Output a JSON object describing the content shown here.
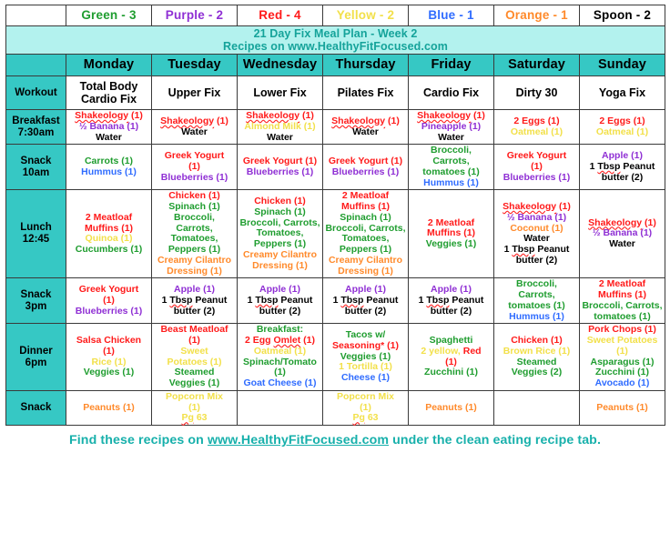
{
  "portions": [
    {
      "label": "Green - 3",
      "color": "#1f9d2f"
    },
    {
      "label": "Purple - 2",
      "color": "#8f2fd4"
    },
    {
      "label": "Red - 4",
      "color": "#ff1a1a"
    },
    {
      "label": "Yellow - 2",
      "color": "#f2e04a"
    },
    {
      "label": "Blue - 1",
      "color": "#2f6cff"
    },
    {
      "label": "Orange - 1",
      "color": "#ff8a2b"
    },
    {
      "label": "Spoon - 2",
      "color": "#000000"
    }
  ],
  "title": {
    "line1": "21 Day Fix Meal Plan - Week 2",
    "line2": "Recipes on www.HealthyFitFocused.com"
  },
  "days": [
    "Monday",
    "Tuesday",
    "Wednesday",
    "Thursday",
    "Friday",
    "Saturday",
    "Sunday"
  ],
  "rows": [
    {
      "label": "Workout",
      "label_line2": "",
      "cells": [
        [
          {
            "text": "Total Body",
            "color": "black"
          },
          {
            "text": "Cardio Fix",
            "color": "black"
          }
        ],
        [
          {
            "text": "Upper Fix",
            "color": "black"
          }
        ],
        [
          {
            "text": "Lower Fix",
            "color": "black"
          }
        ],
        [
          {
            "text": "Pilates Fix",
            "color": "black"
          }
        ],
        [
          {
            "text": "Cardio Fix",
            "color": "black"
          }
        ],
        [
          {
            "text": "Dirty 30",
            "color": "black"
          }
        ],
        [
          {
            "text": "Yoga Fix",
            "color": "black"
          }
        ]
      ]
    },
    {
      "label": "Breakfast",
      "label_line2": "7:30am",
      "cells": [
        [
          {
            "text": "Shakeology (1)",
            "color": "red",
            "spell": "Shakeology"
          },
          {
            "text": "½ Banana (1)",
            "color": "purple"
          },
          {
            "text": "Water",
            "color": "black"
          }
        ],
        [
          {
            "text": "Shakeology (1)",
            "color": "red",
            "spell": "Shakeology"
          },
          {
            "text": "Water",
            "color": "black"
          }
        ],
        [
          {
            "text": "Shakeology (1)",
            "color": "red",
            "spell": "Shakeology"
          },
          {
            "text": "Almond Milk (1)",
            "color": "yellow"
          },
          {
            "text": "Water",
            "color": "black"
          }
        ],
        [
          {
            "text": "Shakeology (1)",
            "color": "red",
            "spell": "Shakeology"
          },
          {
            "text": "Water",
            "color": "black"
          }
        ],
        [
          {
            "text": "Shakeology (1)",
            "color": "red",
            "spell": "Shakeology"
          },
          {
            "text": "Pineapple (1)",
            "color": "purple"
          },
          {
            "text": "Water",
            "color": "black"
          }
        ],
        [
          {
            "text": "2 Eggs (1)",
            "color": "red"
          },
          {
            "text": "Oatmeal (1)",
            "color": "yellow"
          }
        ],
        [
          {
            "text": "2 Eggs (1)",
            "color": "red"
          },
          {
            "text": "Oatmeal (1)",
            "color": "yellow"
          }
        ]
      ]
    },
    {
      "label": "Snack",
      "label_line2": "10am",
      "cells": [
        [
          {
            "text": "Carrots (1)",
            "color": "green"
          },
          {
            "text": "Hummus (1)",
            "color": "blue"
          }
        ],
        [
          {
            "text": "Greek Yogurt",
            "color": "red"
          },
          {
            "text": "(1)",
            "color": "red"
          },
          {
            "text": "Blueberries (1)",
            "color": "purple"
          }
        ],
        [
          {
            "text": "Greek Yogurt (1)",
            "color": "red"
          },
          {
            "text": "Blueberries (1)",
            "color": "purple"
          }
        ],
        [
          {
            "text": "Greek Yogurt (1)",
            "color": "red"
          },
          {
            "text": "Blueberries (1)",
            "color": "purple"
          }
        ],
        [
          {
            "text": "Broccoli,",
            "color": "green"
          },
          {
            "text": "Carrots,",
            "color": "green"
          },
          {
            "text": "tomatoes (1)",
            "color": "green"
          },
          {
            "text": "Hummus (1)",
            "color": "blue"
          }
        ],
        [
          {
            "text": "Greek Yogurt",
            "color": "red"
          },
          {
            "text": "(1)",
            "color": "red"
          },
          {
            "text": "Blueberries (1)",
            "color": "purple"
          }
        ],
        [
          {
            "text": "Apple (1)",
            "color": "purple"
          },
          {
            "text": "1 Tbsp Peanut",
            "color": "black",
            "spell": "Tbsp"
          },
          {
            "text": "butter (2)",
            "color": "black"
          }
        ]
      ]
    },
    {
      "label": "Lunch",
      "label_line2": "12:45",
      "cells": [
        [
          {
            "text": "2 Meatloaf",
            "color": "red"
          },
          {
            "text": "Muffins (1)",
            "color": "red"
          },
          {
            "text": "Quinoa (1)",
            "color": "yellow"
          },
          {
            "text": "Cucumbers (1)",
            "color": "green"
          }
        ],
        [
          {
            "text": "Chicken (1)",
            "color": "red"
          },
          {
            "text": "Spinach (1)",
            "color": "green"
          },
          {
            "text": "Broccoli,",
            "color": "green"
          },
          {
            "text": "Carrots,",
            "color": "green"
          },
          {
            "text": "Tomatoes,",
            "color": "green"
          },
          {
            "text": "Peppers (1)",
            "color": "green"
          },
          {
            "text": "Creamy Cilantro",
            "color": "orange"
          },
          {
            "text": "Dressing (1)",
            "color": "orange"
          }
        ],
        [
          {
            "text": "Chicken (1)",
            "color": "red"
          },
          {
            "text": "Spinach (1)",
            "color": "green"
          },
          {
            "text": "Broccoli, Carrots,",
            "color": "green"
          },
          {
            "text": "Tomatoes,",
            "color": "green"
          },
          {
            "text": "Peppers (1)",
            "color": "green"
          },
          {
            "text": "Creamy Cilantro",
            "color": "orange"
          },
          {
            "text": "Dressing (1)",
            "color": "orange"
          }
        ],
        [
          {
            "text": "2 Meatloaf",
            "color": "red"
          },
          {
            "text": "Muffins (1)",
            "color": "red"
          },
          {
            "text": "Spinach (1)",
            "color": "green"
          },
          {
            "text": "Broccoli, Carrots,",
            "color": "green"
          },
          {
            "text": "Tomatoes,",
            "color": "green"
          },
          {
            "text": "Peppers (1)",
            "color": "green"
          },
          {
            "text": "Creamy Cilantro",
            "color": "orange"
          },
          {
            "text": "Dressing (1)",
            "color": "orange"
          }
        ],
        [
          {
            "text": "2 Meatloaf",
            "color": "red"
          },
          {
            "text": "Muffins (1)",
            "color": "red"
          },
          {
            "text": "Veggies (1)",
            "color": "green"
          }
        ],
        [
          {
            "text": "Shakeology (1)",
            "color": "red",
            "spell": "Shakeology"
          },
          {
            "text": "½ Banana (1)",
            "color": "purple"
          },
          {
            "text": "Coconut (1)",
            "color": "orange"
          },
          {
            "text": "Water",
            "color": "black"
          },
          {
            "text": "1 Tbsp Peanut",
            "color": "black",
            "spell": "Tbsp"
          },
          {
            "text": "butter (2)",
            "color": "black"
          }
        ],
        [
          {
            "text": "Shakeology (1)",
            "color": "red",
            "spell": "Shakeology"
          },
          {
            "text": "½ Banana (1)",
            "color": "purple"
          },
          {
            "text": "Water",
            "color": "black"
          }
        ]
      ]
    },
    {
      "label": "Snack",
      "label_line2": "3pm",
      "cells": [
        [
          {
            "text": "Greek Yogurt",
            "color": "red"
          },
          {
            "text": "(1)",
            "color": "red"
          },
          {
            "text": "Blueberries (1)",
            "color": "purple"
          }
        ],
        [
          {
            "text": "Apple (1)",
            "color": "purple"
          },
          {
            "text": "1 Tbsp Peanut",
            "color": "black",
            "spell": "Tbsp"
          },
          {
            "text": "butter (2)",
            "color": "black"
          }
        ],
        [
          {
            "text": "Apple (1)",
            "color": "purple"
          },
          {
            "text": "1 Tbsp Peanut",
            "color": "black",
            "spell": "Tbsp"
          },
          {
            "text": "butter (2)",
            "color": "black"
          }
        ],
        [
          {
            "text": "Apple (1)",
            "color": "purple"
          },
          {
            "text": "1 Tbsp Peanut",
            "color": "black",
            "spell": "Tbsp"
          },
          {
            "text": "butter (2)",
            "color": "black"
          }
        ],
        [
          {
            "text": "Apple (1)",
            "color": "purple"
          },
          {
            "text": "1 Tbsp Peanut",
            "color": "black",
            "spell": "Tbsp"
          },
          {
            "text": "butter (2)",
            "color": "black"
          }
        ],
        [
          {
            "text": "Broccoli,",
            "color": "green"
          },
          {
            "text": "Carrots,",
            "color": "green"
          },
          {
            "text": "tomatoes (1)",
            "color": "green"
          },
          {
            "text": "Hummus (1)",
            "color": "blue"
          }
        ],
        [
          {
            "text": "2 Meatloaf",
            "color": "red"
          },
          {
            "text": "Muffins (1)",
            "color": "red"
          },
          {
            "text": "Broccoli, Carrots,",
            "color": "green"
          },
          {
            "text": "tomatoes (1)",
            "color": "green"
          }
        ]
      ]
    },
    {
      "label": "Dinner",
      "label_line2": "6pm",
      "cells": [
        [
          {
            "text": "Salsa Chicken",
            "color": "red"
          },
          {
            "text": "(1)",
            "color": "red"
          },
          {
            "text": "Rice (1)",
            "color": "yellow"
          },
          {
            "text": "Veggies (1)",
            "color": "green"
          }
        ],
        [
          {
            "text": "Beast Meatloaf",
            "color": "red"
          },
          {
            "text": "(1)",
            "color": "red"
          },
          {
            "text": "Sweet",
            "color": "yellow"
          },
          {
            "text": "Potatoes (1)",
            "color": "yellow"
          },
          {
            "text": "Steamed",
            "color": "green"
          },
          {
            "text": "Veggies (1)",
            "color": "green"
          }
        ],
        [
          {
            "text": "Breakfast:",
            "color": "green"
          },
          {
            "text": "2 Egg Omlet (1)",
            "color": "red",
            "spell": "Omlet"
          },
          {
            "text": "Oatmeal (1)",
            "color": "yellow"
          },
          {
            "text": "Spinach/Tomato",
            "color": "green"
          },
          {
            "text": "(1)",
            "color": "green"
          },
          {
            "text": "Goat Cheese (1)",
            "color": "blue"
          }
        ],
        [
          {
            "text": "Tacos w/",
            "color": "green"
          },
          {
            "text": "Seasoning* (1)",
            "color": "red"
          },
          {
            "text": "Veggies (1)",
            "color": "green"
          },
          {
            "text": "1 Tortilla (1)",
            "color": "yellow"
          },
          {
            "text": "Cheese (1)",
            "color": "blue"
          }
        ],
        [
          {
            "text": "Spaghetti",
            "color": "green"
          },
          {
            "text": "2 yellow, Red",
            "color": "yellow-red"
          },
          {
            "text": "(1)",
            "color": "red"
          },
          {
            "text": "Zucchini (1)",
            "color": "green"
          }
        ],
        [
          {
            "text": "Chicken (1)",
            "color": "red"
          },
          {
            "text": "Brown Rice (1)",
            "color": "yellow"
          },
          {
            "text": "Steamed",
            "color": "green"
          },
          {
            "text": "Veggies (2)",
            "color": "green"
          }
        ],
        [
          {
            "text": "Pork Chops (1)",
            "color": "red"
          },
          {
            "text": "Sweet Potatoes",
            "color": "yellow"
          },
          {
            "text": "(1)",
            "color": "yellow"
          },
          {
            "text": "Asparagus (1)",
            "color": "green"
          },
          {
            "text": "Zucchini (1)",
            "color": "green"
          },
          {
            "text": "Avocado (1)",
            "color": "blue"
          }
        ]
      ]
    },
    {
      "label": "Snack",
      "label_line2": "",
      "cells": [
        [
          {
            "text": "Peanuts (1)",
            "color": "orange"
          }
        ],
        [
          {
            "text": "Popcorn Mix",
            "color": "yellow"
          },
          {
            "text": "(1)",
            "color": "yellow"
          },
          {
            "text": "Pg 63",
            "color": "yellow",
            "spell": "Pg"
          }
        ],
        [],
        [
          {
            "text": "Popcorn Mix",
            "color": "yellow"
          },
          {
            "text": "(1)",
            "color": "yellow"
          },
          {
            "text": "Pg 63",
            "color": "yellow",
            "spell": "Pg"
          }
        ],
        [
          {
            "text": "Peanuts (1)",
            "color": "orange"
          }
        ],
        [],
        [
          {
            "text": "Peanuts (1)",
            "color": "orange"
          }
        ]
      ]
    }
  ],
  "footer": {
    "before": "Find these recipes on ",
    "link": "www.HealthyFitFocused.com",
    "after": " under the clean eating recipe tab."
  },
  "theme": {
    "teal": "#36c8c4",
    "banner_bg": "#b3f2ee",
    "banner_text": "#15a39a",
    "footer_text": "#17b0ab"
  }
}
